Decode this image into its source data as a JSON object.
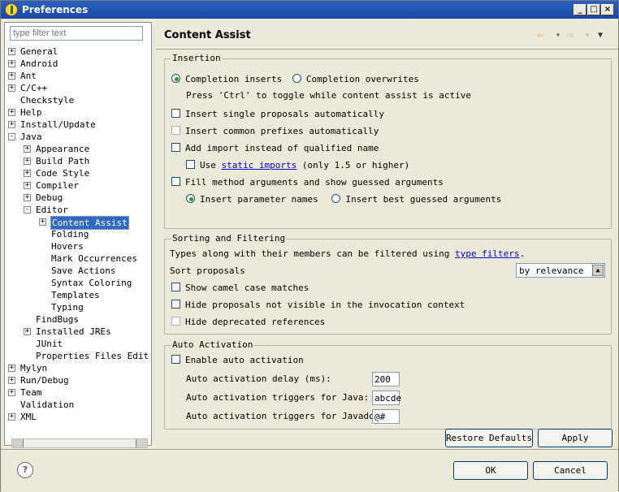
{
  "window": {
    "title": "Preferences",
    "minimize": "_",
    "maximize": "□",
    "close": "×"
  },
  "filter": {
    "placeholder": "type filter text"
  },
  "tree": [
    {
      "label": "General",
      "exp": "+"
    },
    {
      "label": "Android",
      "exp": "+"
    },
    {
      "label": "Ant",
      "exp": "+"
    },
    {
      "label": "C/C++",
      "exp": "+"
    },
    {
      "label": "Checkstyle",
      "exp": ""
    },
    {
      "label": "Help",
      "exp": "+"
    },
    {
      "label": "Install/Update",
      "exp": "+"
    },
    {
      "label": "Java",
      "exp": "-"
    },
    {
      "label": "Appearance",
      "exp": "+"
    },
    {
      "label": "Build Path",
      "exp": "+"
    },
    {
      "label": "Code Style",
      "exp": "+"
    },
    {
      "label": "Compiler",
      "exp": "+"
    },
    {
      "label": "Debug",
      "exp": "+"
    },
    {
      "label": "Editor",
      "exp": "-"
    },
    {
      "label": "Content Assist",
      "exp": "+"
    },
    {
      "label": "Folding",
      "exp": ""
    },
    {
      "label": "Hovers",
      "exp": ""
    },
    {
      "label": "Mark Occurrences",
      "exp": ""
    },
    {
      "label": "Save Actions",
      "exp": ""
    },
    {
      "label": "Syntax Coloring",
      "exp": ""
    },
    {
      "label": "Templates",
      "exp": ""
    },
    {
      "label": "Typing",
      "exp": ""
    },
    {
      "label": "FindBugs",
      "exp": ""
    },
    {
      "label": "Installed JREs",
      "exp": "+"
    },
    {
      "label": "JUnit",
      "exp": ""
    },
    {
      "label": "Properties Files Edit",
      "exp": ""
    },
    {
      "label": "Mylyn",
      "exp": "+"
    },
    {
      "label": "Run/Debug",
      "exp": "+"
    },
    {
      "label": "Team",
      "exp": "+"
    },
    {
      "label": "Validation",
      "exp": ""
    },
    {
      "label": "XML",
      "exp": "+"
    }
  ],
  "page": {
    "title": "Content Assist",
    "nav_back": "⇦",
    "nav_back_menu": "▾",
    "nav_forward": "⇨",
    "nav_forward_menu": "▾",
    "menu": "▼"
  },
  "insertion": {
    "title": "Insertion",
    "completion_inserts": "Completion inserts",
    "completion_overwrites": "Completion overwrites",
    "toggle_hint": "Press 'Ctrl' to toggle while content assist is active",
    "single_proposals": "Insert single proposals automatically",
    "common_prefixes": "Insert common prefixes automatically",
    "add_import": "Add import instead of qualified name",
    "use": "Use",
    "static_imports": "static imports",
    "only15": "(only 1.5 or higher)",
    "fill_args": "Fill method arguments and show guessed arguments",
    "param_names": "Insert parameter names",
    "best_guessed": "Insert best guessed arguments"
  },
  "sorting": {
    "title": "Sorting and Filtering",
    "types_text": "Types along with their members can be filtered using",
    "type_filters": "type filters",
    "period": ".",
    "sort_proposals": "Sort proposals",
    "sort_value": "by relevance",
    "camel_case": "Show camel case matches",
    "hide_not_visible": "Hide proposals not visible in the invocation context",
    "hide_deprecated": "Hide deprecated references"
  },
  "auto": {
    "title": "Auto Activation",
    "enable": "Enable auto activation",
    "delay_label": "Auto activation delay (ms):",
    "delay_value": "200",
    "java_label": "Auto activation triggers for Java:",
    "java_value": "abcde",
    "javadoc_label": "Auto activation triggers for Javadoc:",
    "javadoc_value": "@#"
  },
  "buttons": {
    "restore": "Restore Defaults",
    "apply": "Apply",
    "ok": "OK",
    "cancel": "Cancel",
    "help": "?"
  }
}
